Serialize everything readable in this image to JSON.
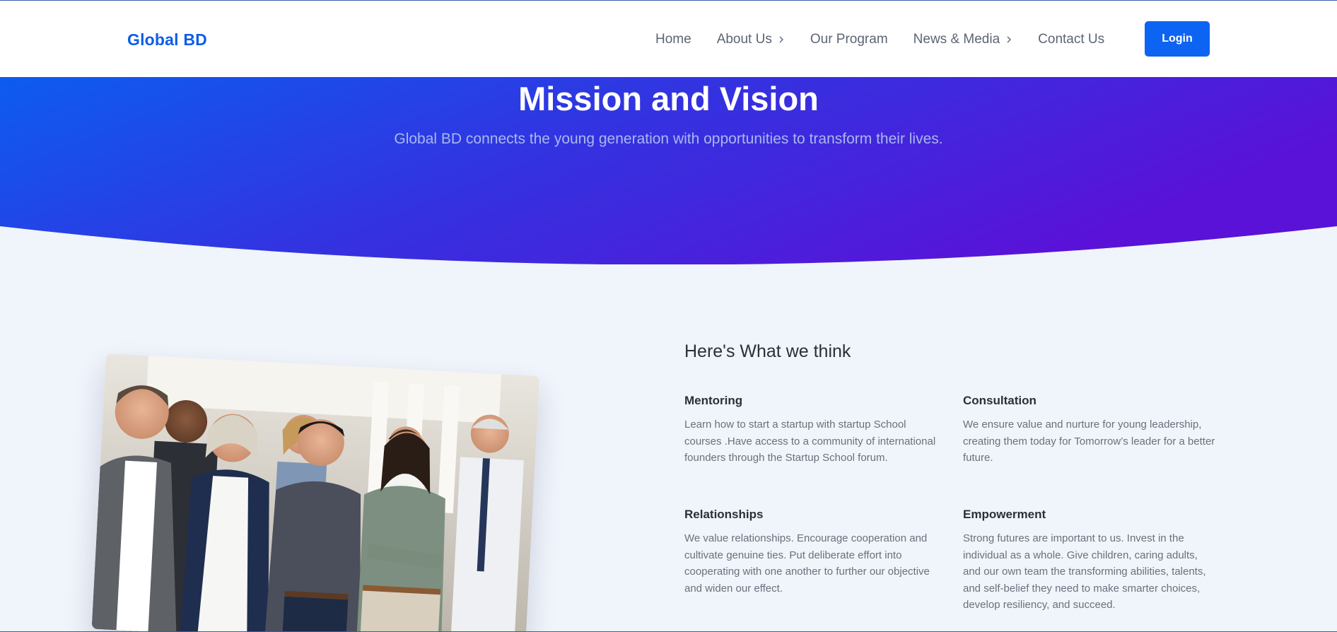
{
  "header": {
    "brand": "Global BD",
    "nav": [
      {
        "label": "Home",
        "has_chevron": false
      },
      {
        "label": "About Us",
        "has_chevron": true
      },
      {
        "label": "Our Program",
        "has_chevron": false
      },
      {
        "label": "News & Media",
        "has_chevron": true
      },
      {
        "label": "Contact Us",
        "has_chevron": false
      }
    ],
    "login_label": "Login"
  },
  "hero": {
    "title": "Mission and Vision",
    "subtitle": "Global BD connects the young generation with opportunities to transform their lives."
  },
  "section": {
    "title": "Here's What we think",
    "features": [
      {
        "title": "Mentoring",
        "text": "Learn how to start a startup with startup School courses .Have access to a community of international founders through the Startup School forum."
      },
      {
        "title": "Consultation",
        "text": "We ensure value and nurture for young leadership, creating them today for Tomorrow’s leader for a better future."
      },
      {
        "title": "Relationships",
        "text": "We value relationships. Encourage cooperation and cultivate genuine ties. Put deliberate effort into cooperating with one another to further our objective and widen our effect."
      },
      {
        "title": "Empowerment",
        "text": "Strong futures are important to us. Invest in the individual as a whole. Give children, caring adults, and our own team the transforming abilities, talents, and self-belief they need to make smarter choices, develop resiliency, and succeed."
      }
    ]
  },
  "colors": {
    "brand": "#0d5de8",
    "login_bg": "#0d64f2",
    "hero_start": "#0d5cf0",
    "hero_end": "#5a12d8",
    "page_bg": "#f0f4fb"
  },
  "icons": {
    "nav_dropdown": "chevron-right-icon"
  }
}
